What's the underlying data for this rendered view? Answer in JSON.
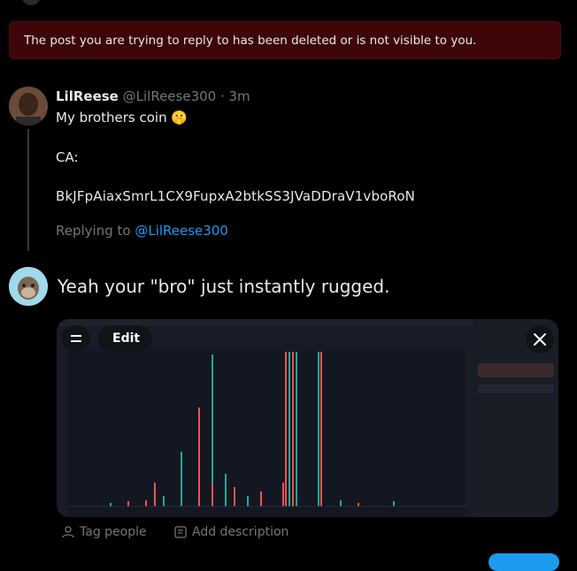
{
  "alert": {
    "text": "The post you are trying to reply to has been deleted or is not visible to you."
  },
  "tweet": {
    "author_name": "LilReese",
    "author_handle": "@LilReese300",
    "separator": " · ",
    "time": "3m",
    "line1": "My brothers coin 🤫",
    "line2": "CA:",
    "line3": "BkJFpAiaxSmrL1CX9FupxA2btkSS3JVaDDraV1vboRoN"
  },
  "replying": {
    "prefix": "Replying to ",
    "mention": "@LilReese300"
  },
  "compose": {
    "text": "Yeah your \"bro\" just instantly rugged."
  },
  "media": {
    "edit_label": "Edit",
    "colors": {
      "green": "#26a69a",
      "red": "#ef5350",
      "bg": "#131722",
      "panel": "#1e222d"
    }
  },
  "media_actions": {
    "tag_people": "Tag people",
    "add_description": "Add description"
  },
  "colors": {
    "alert_bg": "#3d0608",
    "link": "#1d9bf0",
    "muted": "#71767b",
    "text": "#e7e9ea"
  }
}
